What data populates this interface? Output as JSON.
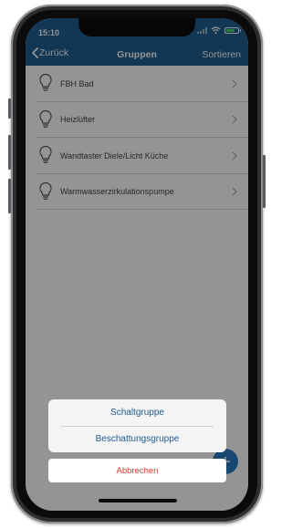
{
  "status_bar": {
    "time": "15:10",
    "wifi_icon": "wifi-icon",
    "battery_icon": "battery-icon"
  },
  "nav": {
    "back_label": "Zurück",
    "title": "Gruppen",
    "action_label": "Sortieren"
  },
  "list": {
    "items": [
      {
        "label": "FBH Bad",
        "icon": "lightbulb-icon"
      },
      {
        "label": "Heizlüfter",
        "icon": "lightbulb-icon"
      },
      {
        "label": "Wandtaster Diele/Licht Küche",
        "icon": "lightbulb-icon"
      },
      {
        "label": "Warmwasserzirkulationspumpe",
        "icon": "lightbulb-icon"
      }
    ]
  },
  "action_sheet": {
    "options": [
      {
        "label": "Schaltgruppe"
      },
      {
        "label": "Beschattungsgruppe"
      }
    ],
    "cancel_label": "Abbrechen"
  },
  "fab_icon": "plus-icon",
  "colors": {
    "nav_bar": "#1f5f93",
    "sheet_option_text": "#1e5a8f",
    "cancel_text": "#e0342c",
    "battery_fill": "#4cd964",
    "fab": "#2a7cc4"
  }
}
